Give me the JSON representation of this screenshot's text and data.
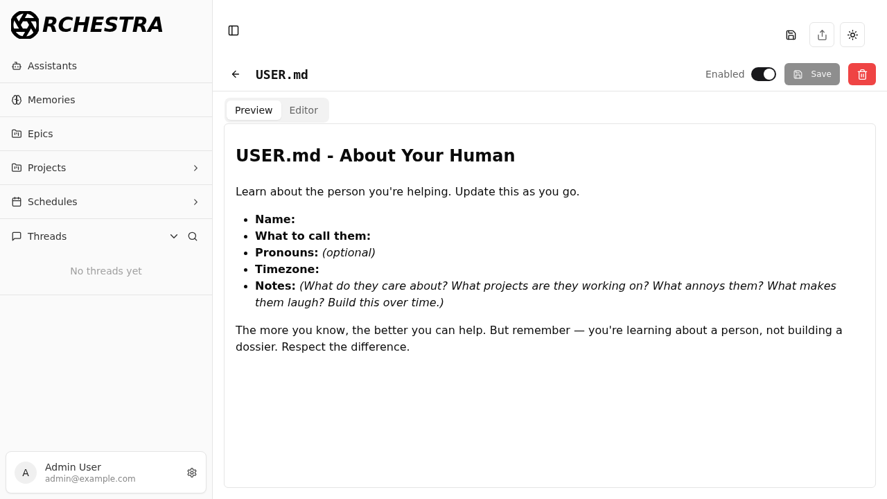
{
  "sidebar": {
    "logo": {
      "text": "RCHESTRA"
    },
    "nav": [
      {
        "label": "Assistants",
        "kind": "link"
      },
      {
        "label": "Memories",
        "kind": "link"
      },
      {
        "label": "Epics",
        "kind": "link"
      },
      {
        "label": "Projects",
        "kind": "group",
        "expanded": false
      },
      {
        "label": "Schedules",
        "kind": "group",
        "expanded": false
      }
    ],
    "threads": {
      "label": "Threads",
      "expanded": true,
      "empty_text": "No threads yet"
    },
    "user": {
      "avatar": "A",
      "name": "Admin User",
      "email": "admin@example.com"
    }
  },
  "document": {
    "title": "USER.md",
    "enabled_label": "Enabled",
    "enabled": true,
    "save_button": {
      "label": "Save",
      "disabled": true
    },
    "tabs": [
      {
        "label": "Preview",
        "selected": true
      },
      {
        "label": "Editor",
        "selected": false
      }
    ],
    "content": [
      {
        "kind": "heading",
        "text": "USER.md - About Your Human"
      },
      {
        "kind": "paragraph",
        "text": "Learn about the person you're helping. Update this as you go."
      },
      {
        "kind": "list",
        "items": [
          "**Name:**",
          "**What to call them:**",
          "**Pronouns:** *(optional)*",
          "**Timezone:**",
          "**Notes:** *(What do they care about? What projects are they working on? What annoys them? What makes them laugh? Build this over time.)*"
        ]
      },
      {
        "kind": "paragraph",
        "text": "The more you know, the better you can help. But remember — you're learning about a person, not building a dossier. Respect the difference."
      }
    ]
  }
}
